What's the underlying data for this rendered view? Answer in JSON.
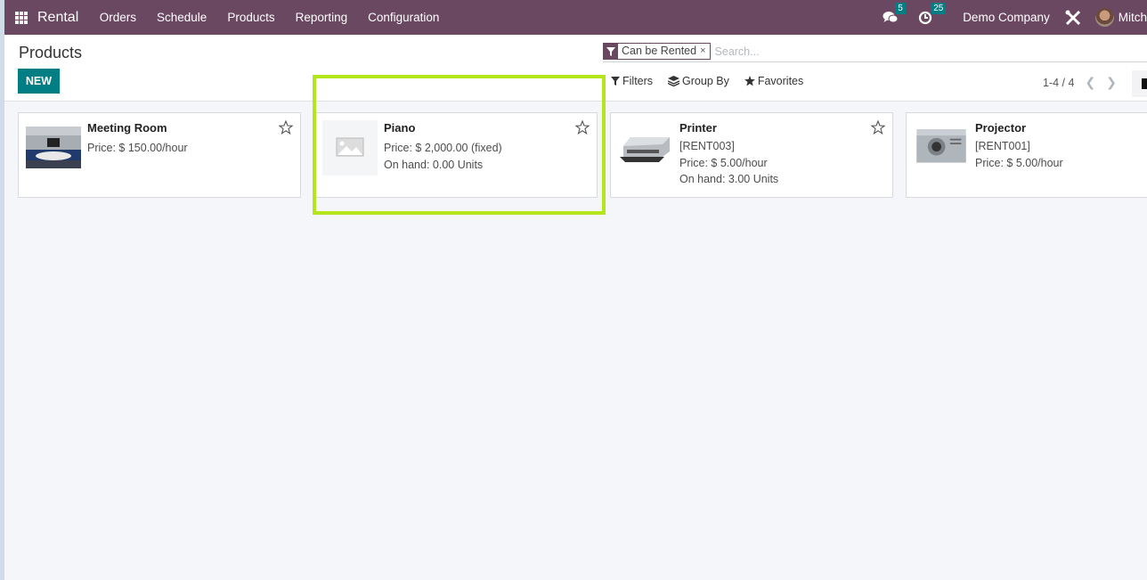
{
  "navbar": {
    "app_name": "Rental",
    "menu": [
      "Orders",
      "Schedule",
      "Products",
      "Reporting",
      "Configuration"
    ],
    "messages_badge": "5",
    "activities_badge": "25",
    "company": "Demo Company",
    "user": "Mitch"
  },
  "control_panel": {
    "title": "Products",
    "new_label": "NEW",
    "facet_label": "Can be Rented",
    "facet_close": "×",
    "search_placeholder": "Search...",
    "filters_label": "Filters",
    "group_by_label": "Group By",
    "favorites_label": "Favorites",
    "pager": "1-4 / 4"
  },
  "products": [
    {
      "name": "Meeting Room",
      "ref": null,
      "price": "Price: $ 150.00/hour",
      "on_hand": null
    },
    {
      "name": "Piano",
      "ref": null,
      "price": "Price: $ 2,000.00 (fixed)",
      "on_hand": "On hand: 0.00 Units"
    },
    {
      "name": "Printer",
      "ref": "[RENT003]",
      "price": "Price: $ 5.00/hour",
      "on_hand": "On hand: 3.00 Units"
    },
    {
      "name": "Projector",
      "ref": "[RENT001]",
      "price": "Price: $ 5.00/hour",
      "on_hand": null
    }
  ],
  "colors": {
    "navbar": "#6b4862",
    "primary": "#017e84",
    "highlight": "#b5e61d"
  }
}
